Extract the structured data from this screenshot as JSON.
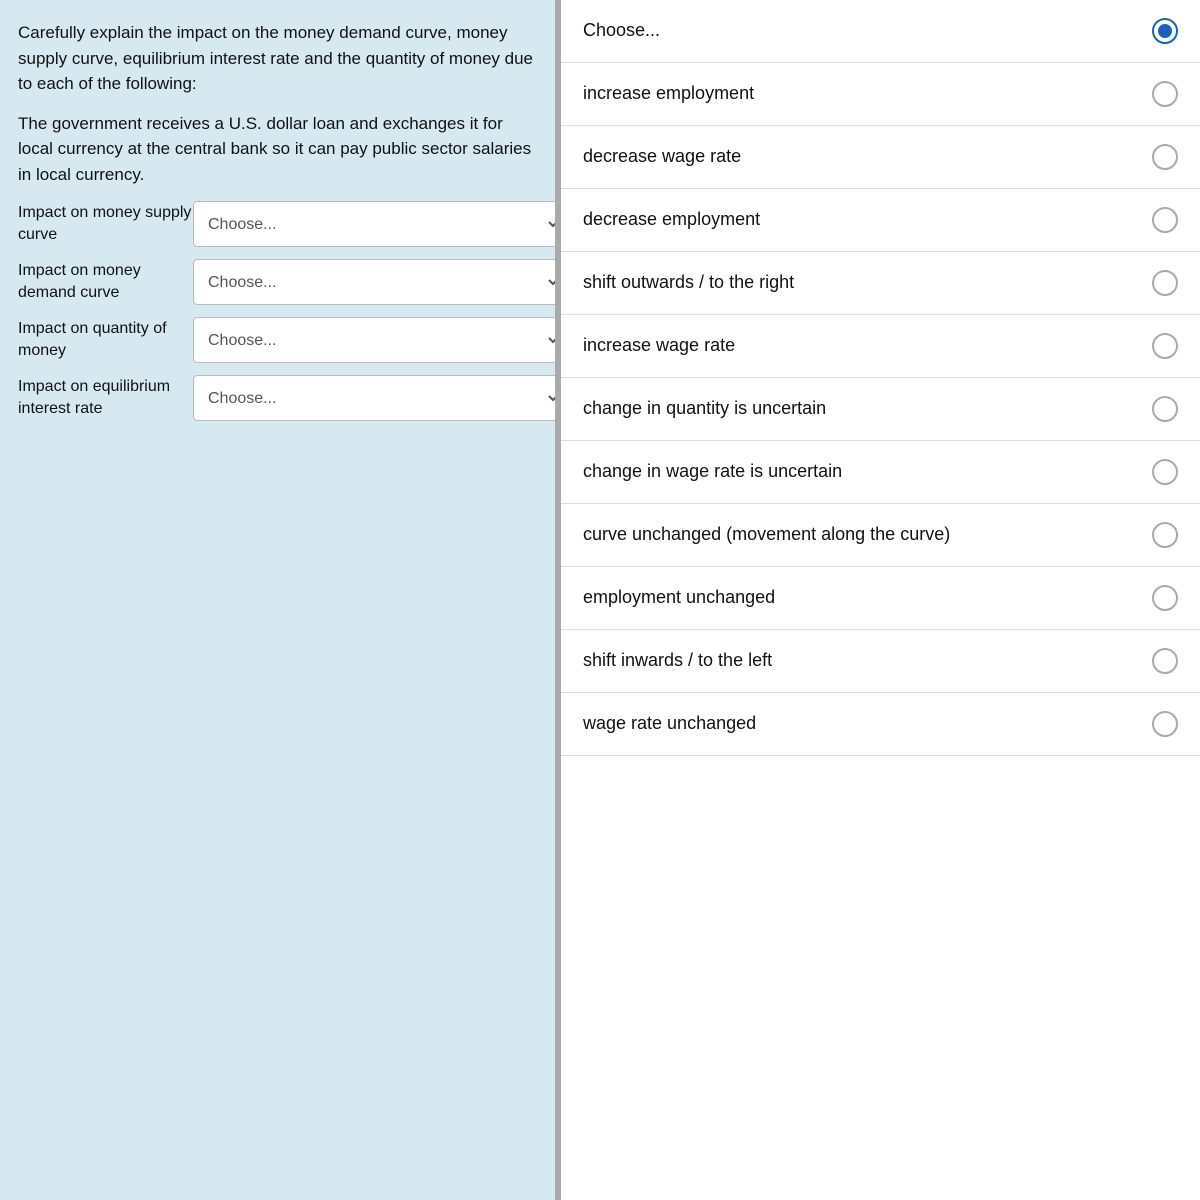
{
  "left": {
    "description1": "Carefully explain the impact on the money demand curve, money supply curve, equilibrium interest rate and the quantity of money due to each of the following:",
    "description2": "The government receives a U.S. dollar loan and exchanges it for local currency at the central bank so it can pay public sector salaries in local currency.",
    "impacts": [
      {
        "label": "Impact on money supply curve",
        "select_placeholder": "Choose...",
        "id": "select-money-supply"
      },
      {
        "label": "Impact on money demand curve",
        "select_placeholder": "Choose...",
        "id": "select-money-demand"
      },
      {
        "label": "Impact on quantity of money",
        "select_placeholder": "Choose...",
        "id": "select-quantity"
      },
      {
        "label": "Impact on equilibrium interest rate",
        "select_placeholder": "Choose...",
        "id": "select-equilibrium"
      }
    ]
  },
  "right": {
    "options": [
      {
        "label": "Choose...",
        "selected": true
      },
      {
        "label": "increase employment",
        "selected": false
      },
      {
        "label": "decrease wage rate",
        "selected": false
      },
      {
        "label": "decrease employment",
        "selected": false
      },
      {
        "label": "shift outwards / to the right",
        "selected": false
      },
      {
        "label": "increase wage rate",
        "selected": false
      },
      {
        "label": "change in quantity is uncertain",
        "selected": false
      },
      {
        "label": "change in wage rate is uncertain",
        "selected": false
      },
      {
        "label": "curve unchanged (movement along the curve)",
        "selected": false
      },
      {
        "label": "employment unchanged",
        "selected": false
      },
      {
        "label": "shift inwards / to the left",
        "selected": false
      },
      {
        "label": "wage rate unchanged",
        "selected": false
      }
    ]
  }
}
